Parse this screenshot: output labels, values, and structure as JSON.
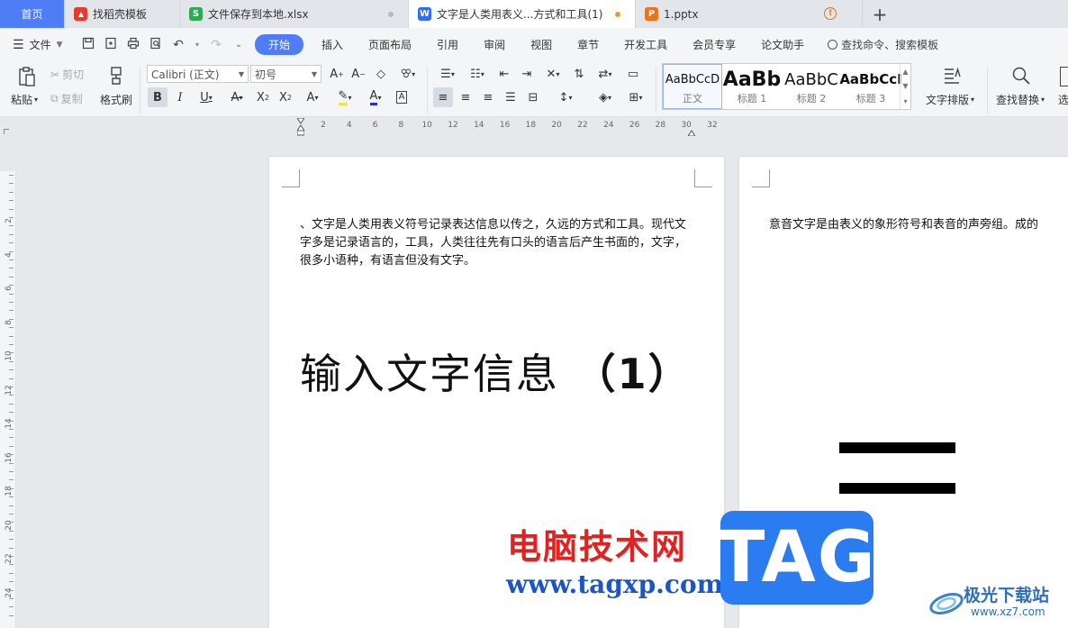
{
  "tabs": [
    {
      "label": "首页",
      "icon": ""
    },
    {
      "label": "找稻壳模板",
      "icon": "daoke-icon",
      "icon_color": "#e33b2e"
    },
    {
      "label": "文件保存到本地.xlsx",
      "icon": "spreadsheet-icon",
      "icon_color": "#2eaa52",
      "icon_glyph": "S"
    },
    {
      "label": "文字是人类用表义...方式和工具(1)",
      "icon": "writer-icon",
      "icon_color": "#2f6ff0",
      "icon_glyph": "W",
      "modified_dot_color": "#e3a21a"
    },
    {
      "label": "1.pptx",
      "icon": "presentation-icon",
      "icon_color": "#e8741c",
      "icon_glyph": "P",
      "warning_glyph": "!"
    }
  ],
  "add_tab_glyph": "+",
  "menu": {
    "file_label": "文件",
    "items": [
      "开始",
      "插入",
      "页面布局",
      "引用",
      "审阅",
      "视图",
      "章节",
      "开发工具",
      "会员专享",
      "论文助手"
    ],
    "active_index": 0,
    "search_label": "查找命令、搜索模板"
  },
  "ribbon": {
    "paste_label": "粘贴",
    "cut_label": "剪切",
    "copy_label": "复制",
    "format_painter_label": "格式刷",
    "font_name": "Calibri (正文)",
    "font_size": "初号",
    "styles": [
      {
        "preview": "AaBbCcD",
        "name": "正文"
      },
      {
        "preview": "AaBb",
        "name": "标题 1"
      },
      {
        "preview": "AaBbC",
        "name": "标题 2"
      },
      {
        "preview": "AaBbCcI",
        "name": "标题 3"
      }
    ],
    "text_layout_label": "文字排版",
    "find_replace_label": "查找替换",
    "select_label": "选"
  },
  "ruler_ticks": [
    "2",
    "4",
    "6",
    "8",
    "10",
    "12",
    "14",
    "16",
    "18",
    "20",
    "22",
    "24",
    "26",
    "28",
    "30",
    "32"
  ],
  "vruler_ticks": [
    "2",
    "4",
    "6",
    "8",
    "10",
    "12",
    "14",
    "16",
    "18",
    "20",
    "22",
    "24"
  ],
  "page1": {
    "paragraph": "、文字是人类用表义符号记录表达信息以传之，久远的方式和工具。现代文字多是记录语言的，工具，人类往往先有口头的语言后产生书面的，文字，很多小语种，有语言但没有文字。",
    "heading": "输入文字信息 ",
    "heading_num": "（1）"
  },
  "page2": {
    "paragraph": "意音文字是由表义的象形符号和表音的声旁组。成的"
  },
  "watermarks": {
    "cn": "电脑技术网",
    "url": "www.tagxp.com",
    "tag": "TAG",
    "site_cn": "极光下载站",
    "site_en": "www.xz7.com"
  }
}
